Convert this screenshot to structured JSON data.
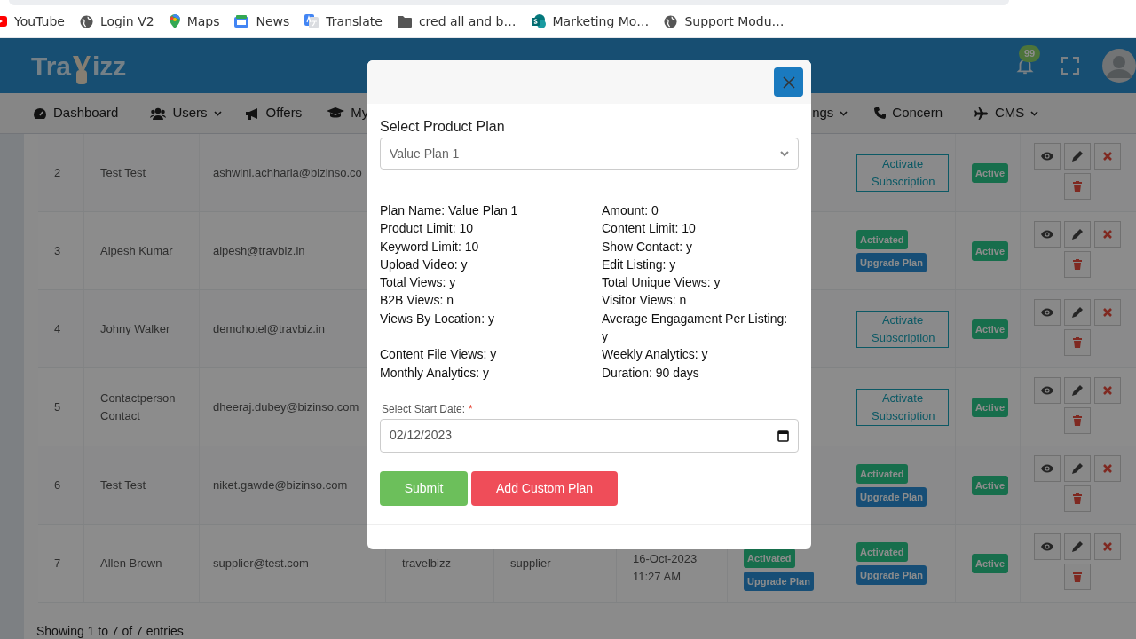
{
  "bookmarks": [
    {
      "label": "YouTube"
    },
    {
      "label": "Login V2"
    },
    {
      "label": "Maps"
    },
    {
      "label": "News"
    },
    {
      "label": "Translate"
    },
    {
      "label": "cred all  and b…"
    },
    {
      "label": "Marketing Mo…"
    },
    {
      "label": "Support Modu…"
    }
  ],
  "header": {
    "logo": {
      "left": "Tra",
      "right": "izz"
    },
    "notification_count": "99"
  },
  "nav": [
    {
      "label": "Dashboard",
      "has_dropdown": false
    },
    {
      "label": "Users",
      "has_dropdown": true
    },
    {
      "label": "Offers",
      "has_dropdown": false
    },
    {
      "label": "My",
      "has_dropdown": false
    },
    {
      "label": "ngs",
      "has_dropdown": true
    },
    {
      "label": "Concern",
      "has_dropdown": false
    },
    {
      "label": "CMS",
      "has_dropdown": true
    }
  ],
  "table": {
    "rows": [
      {
        "number": "2",
        "name": "Test Test",
        "email": "ashwini.achharia@bizinso.co",
        "subscription": [
          {
            "kind": "activate",
            "label": "Activate Subscription"
          }
        ],
        "status": "Active"
      },
      {
        "number": "3",
        "name": "Alpesh Kumar",
        "email": "alpesh@travbiz.in",
        "subscription": [
          {
            "kind": "activated",
            "label": "Activated"
          },
          {
            "kind": "upgrade",
            "label": "Upgrade Plan"
          }
        ],
        "status": "Active"
      },
      {
        "number": "4",
        "name": "Johny Walker",
        "email": "demohotel@travbiz.in",
        "subscription": [
          {
            "kind": "activate",
            "label": "Activate Subscription"
          }
        ],
        "status": "Active"
      },
      {
        "number": "5",
        "name": "Contactperson Contact",
        "email": "dheeraj.dubey@bizinso.com",
        "subscription": [
          {
            "kind": "activate",
            "label": "Activate Subscription"
          }
        ],
        "status": "Active"
      },
      {
        "number": "6",
        "name": "Test Test",
        "email": "niket.gawde@bizinso.com",
        "subscription": [
          {
            "kind": "activated",
            "label": "Activated"
          },
          {
            "kind": "upgrade",
            "label": "Upgrade Plan"
          }
        ],
        "status": "Active"
      },
      {
        "number": "7",
        "name": "Allen Brown",
        "email": "supplier@test.com",
        "company": "travelbizz",
        "role": "supplier",
        "date": "16-Oct-2023",
        "time": "11:27 AM",
        "plan": [
          {
            "kind": "activated",
            "label": "Activated"
          },
          {
            "kind": "upgrade",
            "label": "Upgrade Plan"
          }
        ],
        "subscription": [
          {
            "kind": "activated",
            "label": "Activated"
          },
          {
            "kind": "upgrade",
            "label": "Upgrade Plan"
          }
        ],
        "status": "Active"
      }
    ],
    "footer": "Showing 1 to 7 of 7 entries"
  },
  "modal": {
    "plan_label": "Select Product Plan",
    "plan_value": "Value Plan 1",
    "details": [
      {
        "left": "Plan Name: Value Plan 1",
        "right": "Amount: 0"
      },
      {
        "left": "Product Limit: 10",
        "right": "Content Limit: 10"
      },
      {
        "left": "Keyword Limit: 10",
        "right": "Show Contact: y"
      },
      {
        "left": "Upload Video: y",
        "right": "Edit Listing: y"
      },
      {
        "left": "Total Views: y",
        "right": "Total Unique Views: y"
      },
      {
        "left": "B2B Views: n",
        "right": "Visitor Views: n"
      },
      {
        "left": "Views By Location: y",
        "right": "Average Engagament Per Listing: y"
      },
      {
        "left": "Content File Views: y",
        "right": "Weekly Analytics: y"
      },
      {
        "left": "Monthly Analytics: y",
        "right": "Duration: 90 days"
      }
    ],
    "date_label": "Select Start Date:",
    "required_mark": "*",
    "date_value": "02/12/2023",
    "buttons": [
      {
        "kind": "submit",
        "label": "Submit"
      },
      {
        "kind": "custom",
        "label": "Add Custom Plan"
      }
    ]
  }
}
